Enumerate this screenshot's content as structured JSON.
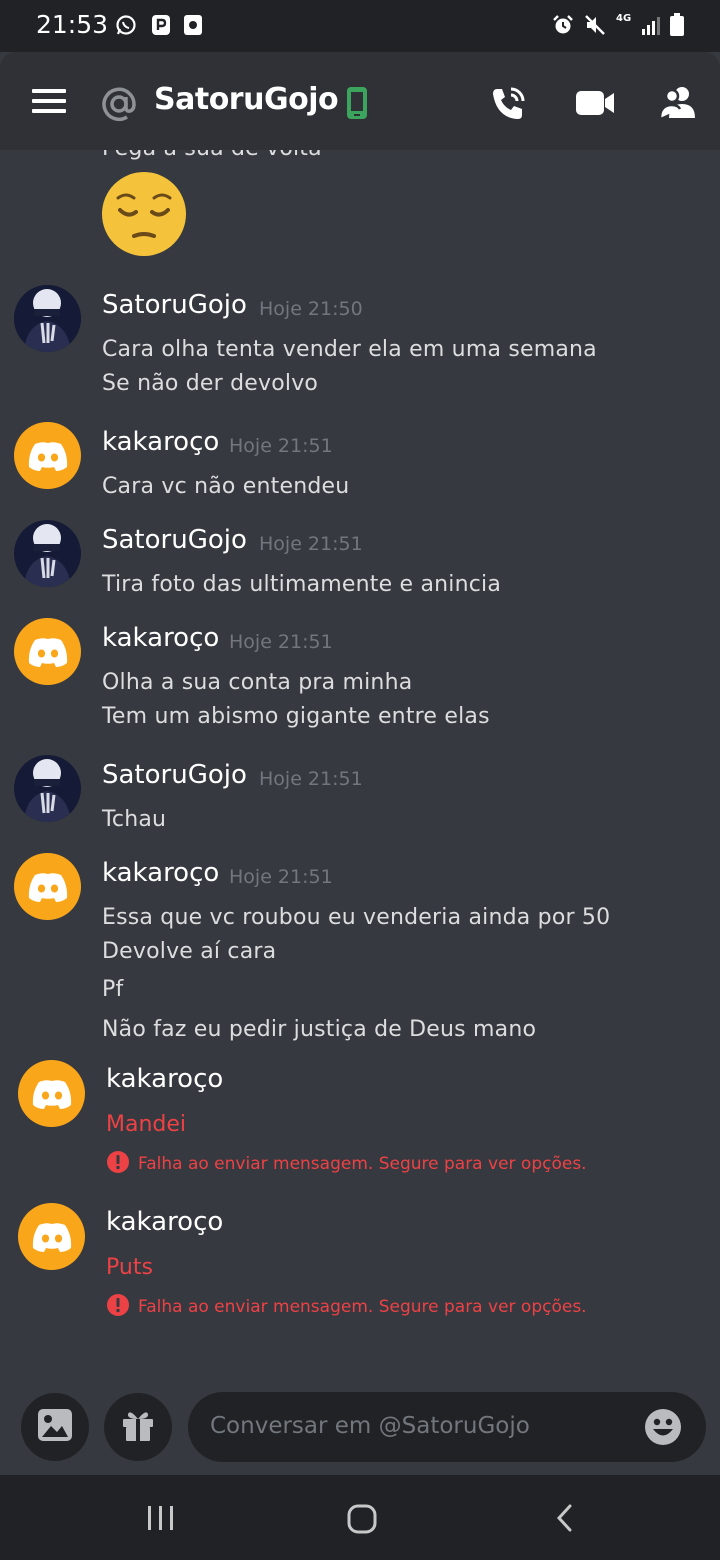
{
  "status_bar": {
    "time": "21:53",
    "network": "4G"
  },
  "header": {
    "channel_prefix": "@",
    "title": "SatoruGojo"
  },
  "partial_message": {
    "text": "Pega a sua de volta",
    "emoji": "😔"
  },
  "messages": [
    {
      "author": "SatoruGojo",
      "timestamp": "Hoje 21:50",
      "lines": [
        "Cara olha tenta vender ela em uma semana",
        "Se não der devolvo"
      ]
    },
    {
      "author": "kakaroço",
      "timestamp": "Hoje 21:51",
      "lines": [
        "Cara vc não entendeu"
      ]
    },
    {
      "author": "SatoruGojo",
      "timestamp": "Hoje 21:51",
      "lines": [
        "Tira foto das ultimamente e anincia"
      ]
    },
    {
      "author": "kakaroço",
      "timestamp": "Hoje 21:51",
      "lines": [
        "Olha a sua conta pra minha",
        "Tem um abismo gigante entre elas"
      ]
    },
    {
      "author": "SatoruGojo",
      "timestamp": "Hoje 21:51",
      "lines": [
        "Tchau"
      ]
    },
    {
      "author": "kakaroço",
      "timestamp": "Hoje 21:51",
      "lines": [
        "Essa que vc roubou eu venderia ainda por 50",
        "Devolve aí cara",
        "Pf",
        "Não faz eu pedir justiça de Deus mano"
      ]
    }
  ],
  "failed_messages": [
    {
      "author": "kakaroço",
      "text": "Mandei",
      "error": "Falha ao enviar mensagem. Segure para ver opções."
    },
    {
      "author": "kakaroço",
      "text": "Puts",
      "error": "Falha ao enviar mensagem. Segure para ver opções."
    }
  ],
  "input": {
    "placeholder": "Conversar em @SatoruGojo"
  },
  "colors": {
    "background": "#36393f",
    "header": "#2f3136",
    "dark": "#202225",
    "accent_orange": "#faa61a",
    "error": "#ed4245",
    "online": "#3ba55d"
  }
}
